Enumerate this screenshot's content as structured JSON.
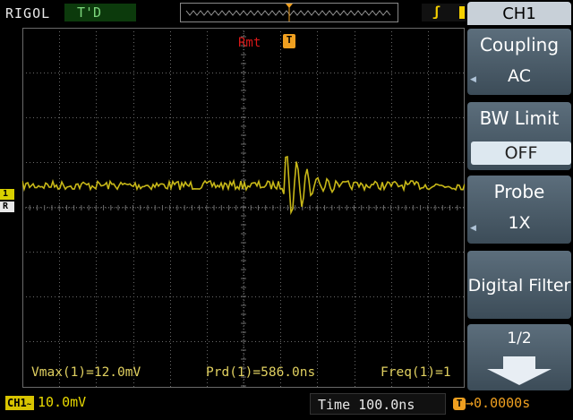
{
  "header": {
    "brand": "RIGOL",
    "trigger_status": "T'D"
  },
  "trigger": {
    "source_label": "Rmt",
    "marker": "T"
  },
  "markers": {
    "channel": "1",
    "reference": "R"
  },
  "measurements": [
    {
      "label": "Vmax(1)=12.0mV"
    },
    {
      "label": "Prd(1)=586.0ns"
    },
    {
      "label": "Freq(1)=1"
    }
  ],
  "footer": {
    "channel_badge": "CH1",
    "channel_scale": "10.0mV",
    "time_label": "Time 100.0ns",
    "trigger_offset": "0.0000s",
    "trigger_offset_icon": "T"
  },
  "menu": {
    "title": "CH1",
    "coupling_label": "Coupling",
    "coupling_value": "AC",
    "bw_label": "BW Limit",
    "bw_value": "OFF",
    "probe_label": "Probe",
    "probe_value": "1X",
    "filter_label": "Digital Filter",
    "page": "1/2"
  },
  "colors": {
    "trace": "#c8b818",
    "grid": "#6a6a6a",
    "accent": "#f0a020"
  },
  "icons": {
    "next-page": "arrow-down-icon",
    "menu-arrow": "triangle-left-icon"
  }
}
